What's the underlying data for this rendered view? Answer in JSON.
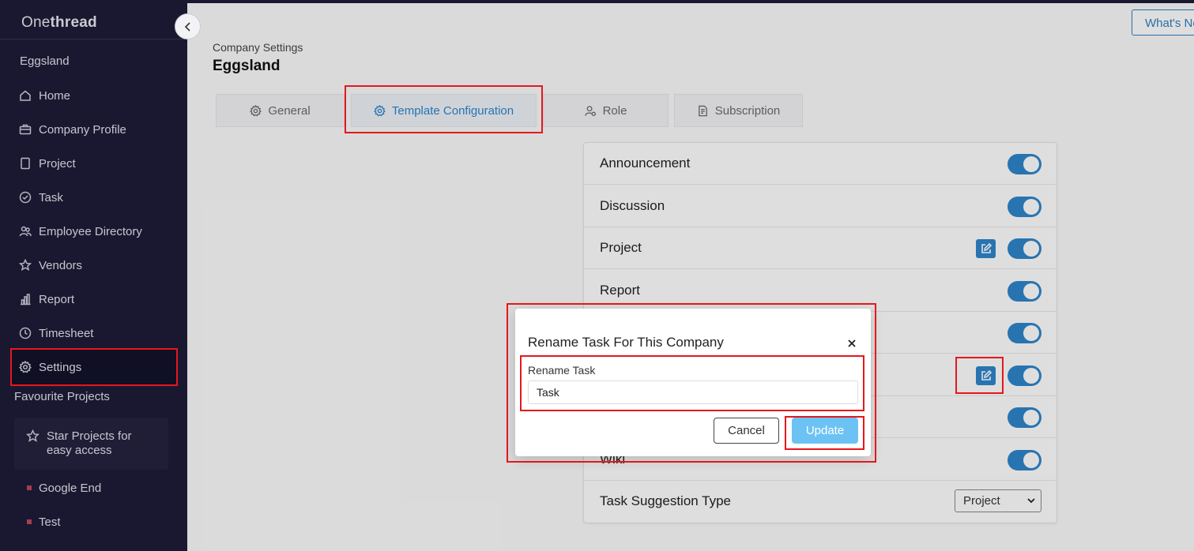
{
  "app": {
    "brand_light": "One",
    "brand_bold": "thread"
  },
  "sidebar": {
    "company": "Eggsland",
    "items": [
      {
        "label": "Home",
        "icon": "home-icon"
      },
      {
        "label": "Company Profile",
        "icon": "briefcase-icon"
      },
      {
        "label": "Project",
        "icon": "document-icon"
      },
      {
        "label": "Task",
        "icon": "check-circle-icon"
      },
      {
        "label": "Employee Directory",
        "icon": "users-icon"
      },
      {
        "label": "Vendors",
        "icon": "star-icon"
      },
      {
        "label": "Report",
        "icon": "bar-chart-icon"
      },
      {
        "label": "Timesheet",
        "icon": "clock-icon"
      },
      {
        "label": "Settings",
        "icon": "gear-icon"
      }
    ],
    "favourites_title": "Favourite Projects",
    "star_hint_line1": "Star Projects for",
    "star_hint_line2": "easy access",
    "projects": [
      "Google End",
      "Test"
    ]
  },
  "header": {
    "whats_new": "What's New",
    "breadcrumb": "Company Settings",
    "title": "Eggsland"
  },
  "tabs": [
    {
      "label": "General",
      "icon": "gear-icon"
    },
    {
      "label": "Template Configuration",
      "icon": "gear-icon",
      "active": true
    },
    {
      "label": "Role",
      "icon": "user-gear-icon"
    },
    {
      "label": "Subscription",
      "icon": "invoice-icon"
    }
  ],
  "config": {
    "rows": [
      {
        "label": "Announcement",
        "enabled": true
      },
      {
        "label": "Discussion",
        "enabled": true
      },
      {
        "label": "Project",
        "enabled": true,
        "editable": true
      },
      {
        "label": "Report",
        "enabled": true
      },
      {
        "label": "",
        "enabled": true
      },
      {
        "label": "",
        "enabled": true,
        "editable": true
      },
      {
        "label": "",
        "enabled": true
      },
      {
        "label": "Wiki",
        "enabled": true
      }
    ],
    "suggestion_label": "Task Suggestion Type",
    "suggestion_value": "Project"
  },
  "modal": {
    "title": "Rename Task For This Company",
    "field_label": "Rename Task",
    "field_value": "Task",
    "cancel": "Cancel",
    "update": "Update"
  },
  "colors": {
    "sidebar_bg": "#1e1c38",
    "accent": "#2f86cc",
    "update_button": "#6cc3f3",
    "annotation": "#e4181c"
  }
}
